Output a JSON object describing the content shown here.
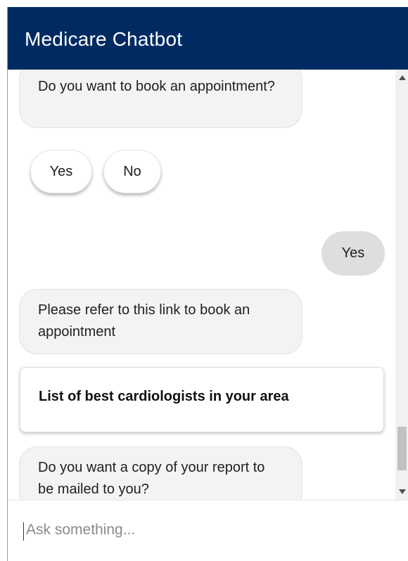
{
  "header": {
    "title": "Medicare Chatbot"
  },
  "messages": {
    "bot_book_question": "Do you want to book an appointment?",
    "quick_replies": {
      "yes": "Yes",
      "no": "No"
    },
    "user_reply": "Yes",
    "bot_refer_link": "Please refer to this link to book an appointment",
    "link_card": "List of best cardiologists in your area",
    "bot_copy_question": "Do you want a copy of your report to be mailed to you?"
  },
  "input": {
    "placeholder": "Ask something..."
  },
  "colors": {
    "header_bg": "#002b62",
    "bot_bubble": "#f3f3f3",
    "user_bubble": "#dedede"
  },
  "icons": {
    "scroll_up": "scroll-up-arrow-icon",
    "scroll_down": "scroll-down-arrow-icon"
  }
}
